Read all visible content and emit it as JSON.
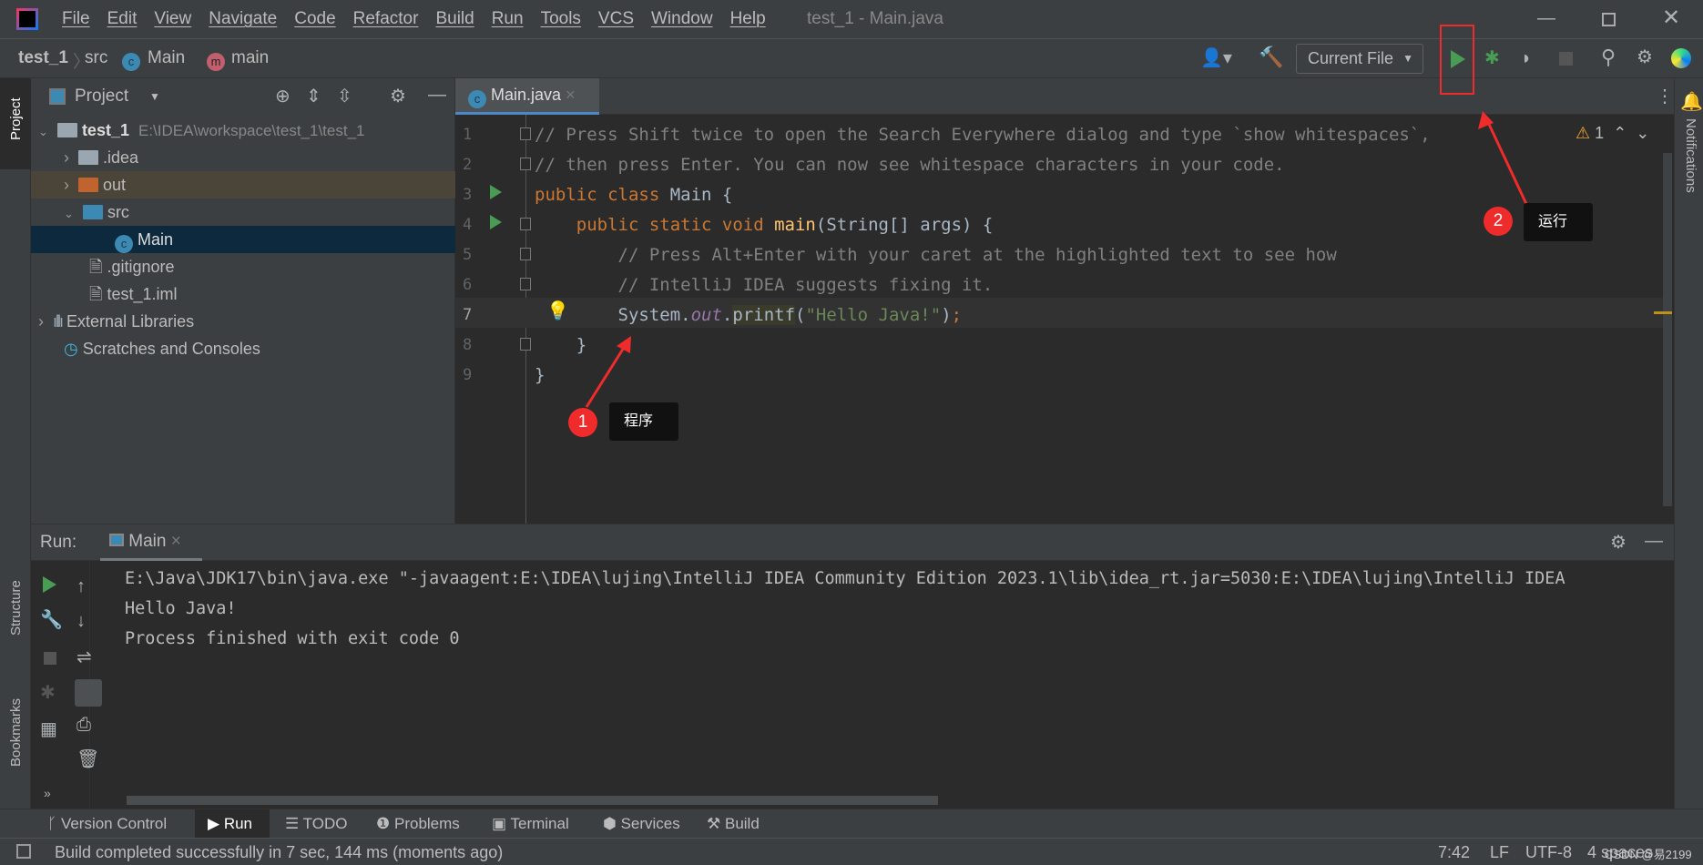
{
  "window": {
    "title": "test_1 - Main.java"
  },
  "menu": [
    "File",
    "Edit",
    "View",
    "Navigate",
    "Code",
    "Refactor",
    "Build",
    "Run",
    "Tools",
    "VCS",
    "Window",
    "Help"
  ],
  "breadcrumb": [
    "test_1",
    "src",
    "Main",
    "main"
  ],
  "toolbar": {
    "run_config": "Current File"
  },
  "project": {
    "title": "Project",
    "root": "test_1",
    "root_path": "E:\\IDEA\\workspace\\test_1\\test_1",
    "items": [
      ".idea",
      "out",
      "src",
      "Main",
      ".gitignore",
      "test_1.iml",
      "External Libraries",
      "Scratches and Consoles"
    ]
  },
  "editor": {
    "tab": "Main.java",
    "warnings": "1",
    "lines": [
      {
        "n": "1",
        "parts": [
          [
            "cm",
            "// Press Shift twice to open the Search Everywhere dialog and type `show whitespaces`,"
          ]
        ]
      },
      {
        "n": "2",
        "parts": [
          [
            "cm",
            "// then press Enter. You can now see whitespace characters in your code."
          ]
        ]
      },
      {
        "n": "3",
        "parts": [
          [
            "kw",
            "public class "
          ],
          [
            "",
            "Main {"
          ]
        ]
      },
      {
        "n": "4",
        "parts": [
          [
            "",
            "    "
          ],
          [
            "kw",
            "public static void "
          ],
          [
            "fn",
            "main"
          ],
          [
            "",
            "(String[] args) {"
          ]
        ]
      },
      {
        "n": "5",
        "parts": [
          [
            "cm",
            "        // Press Alt+Enter with your caret at the highlighted text to see how"
          ]
        ]
      },
      {
        "n": "6",
        "parts": [
          [
            "cm",
            "        // IntelliJ IDEA suggests fixing it."
          ]
        ]
      },
      {
        "n": "7",
        "parts": [
          [
            "",
            "        System."
          ],
          [
            "it",
            "out"
          ],
          [
            "",
            "."
          ],
          [
            "hl",
            "printf"
          ],
          [
            "",
            "("
          ],
          [
            "st",
            "\"Hello Java!\""
          ],
          [
            "",
            ")"
          ],
          [
            "kw",
            ";"
          ]
        ]
      },
      {
        "n": "8",
        "parts": [
          [
            "",
            "    }"
          ]
        ]
      },
      {
        "n": "9",
        "parts": [
          [
            "",
            "}"
          ]
        ]
      }
    ]
  },
  "run": {
    "label": "Run:",
    "tab": "Main",
    "output": [
      "E:\\Java\\JDK17\\bin\\java.exe \"-javaagent:E:\\IDEA\\lujing\\IntelliJ IDEA Community Edition 2023.1\\lib\\idea_rt.jar=5030:E:\\IDEA\\lujing\\IntelliJ IDEA",
      "Hello Java!",
      "Process finished with exit code 0"
    ]
  },
  "side": {
    "project": "Project",
    "structure": "Structure",
    "bookmarks": "Bookmarks",
    "notifications": "Notifications"
  },
  "bottom_tabs": [
    "Version Control",
    "Run",
    "TODO",
    "Problems",
    "Terminal",
    "Services",
    "Build"
  ],
  "status": {
    "message": "Build completed successfully in 7 sec, 144 ms (moments ago)",
    "position": "7:42",
    "line_sep": "LF",
    "encoding": "UTF-8",
    "indent": "4 spaces",
    "watermark": "CSDN @易2199"
  },
  "annotations": [
    {
      "num": "1",
      "text": "程序"
    },
    {
      "num": "2",
      "text": "运行"
    }
  ],
  "colors": {
    "accent_run": "#499c54",
    "annotation": "#ef2b2b",
    "selection": "#0d293e"
  }
}
